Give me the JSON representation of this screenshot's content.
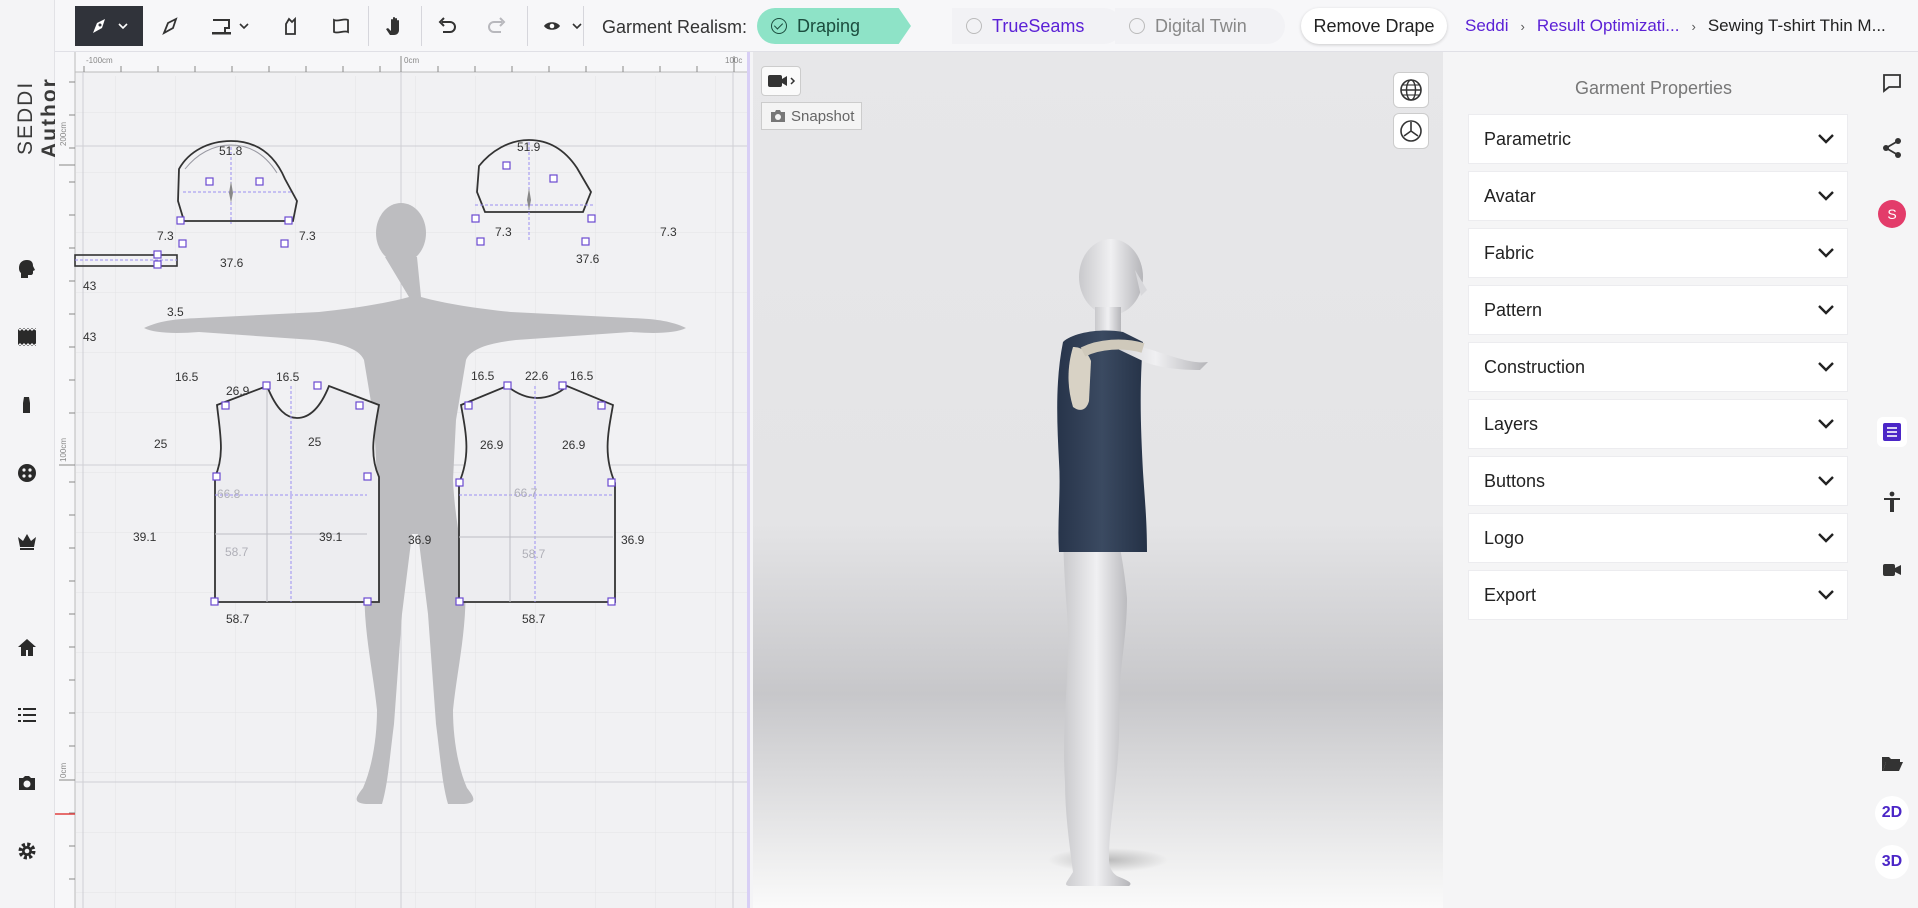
{
  "app": {
    "logo_plain": "SEDDI",
    "logo_bold": "Author"
  },
  "sidebar_left": {
    "items": [
      "head-icon",
      "fabric-icon",
      "piece-icon",
      "button-icon",
      "crown-icon",
      "home-icon",
      "list-icon",
      "camera-icon",
      "settings-icon"
    ]
  },
  "toolbar": {
    "realism_label": "Garment Realism:",
    "modes": [
      {
        "label": "Draping",
        "state": "selected"
      },
      {
        "label": "TrueSeams",
        "state": "available"
      },
      {
        "label": "Digital Twin",
        "state": "disabled"
      }
    ],
    "remove_drape": "Remove Drape"
  },
  "breadcrumb": {
    "items": [
      "Seddi",
      "Result Optimizati...",
      "Sewing T-shirt Thin M..."
    ]
  },
  "pattern_2d": {
    "ruler_top": [
      "-100cm",
      "0cm",
      "100c"
    ],
    "ruler_left": [
      "200cm",
      "100cm",
      "0cm"
    ],
    "sleeve_left": {
      "top": "51.8",
      "left": "7.3",
      "right": "7.3",
      "bottom": "37.6"
    },
    "sleeve_right": {
      "top": "51.9",
      "left": "7.3",
      "right": "7.3",
      "bottom": "37.6"
    },
    "collar": {
      "top": "43",
      "bottom": "43",
      "right": "3.5"
    },
    "front": {
      "shoulder_l": "16.5",
      "neck": "26.9",
      "shoulder_r": "16.5",
      "arm_l": "25",
      "arm_r": "25",
      "side_l": "39.1",
      "side_r": "39.1",
      "bottom": "58.7",
      "inner_w": "58.7",
      "inner_h": "66.8"
    },
    "back": {
      "shoulder_l": "16.5",
      "neck": "22.6",
      "shoulder_r": "16.5",
      "arm_l": "26.9",
      "arm_r": "26.9",
      "side_l": "36.9",
      "side_r": "36.9",
      "bottom": "58.7",
      "inner_w": "58.7",
      "inner_h": "66.7"
    }
  },
  "viewport_3d": {
    "snapshot": "Snapshot"
  },
  "properties": {
    "title": "Garment Properties",
    "sections": [
      "Parametric",
      "Avatar",
      "Fabric",
      "Pattern",
      "Construction",
      "Layers",
      "Buttons",
      "Logo",
      "Export"
    ]
  },
  "sidebar_right": {
    "avatar_initial": "S",
    "mode_2d": "2D",
    "mode_3d": "3D"
  },
  "colors": {
    "accent": "#5b21d6",
    "draping_chip": "#8ee3c7",
    "shirt": "#2f3d52",
    "avatar_badge": "#e33c6a"
  }
}
